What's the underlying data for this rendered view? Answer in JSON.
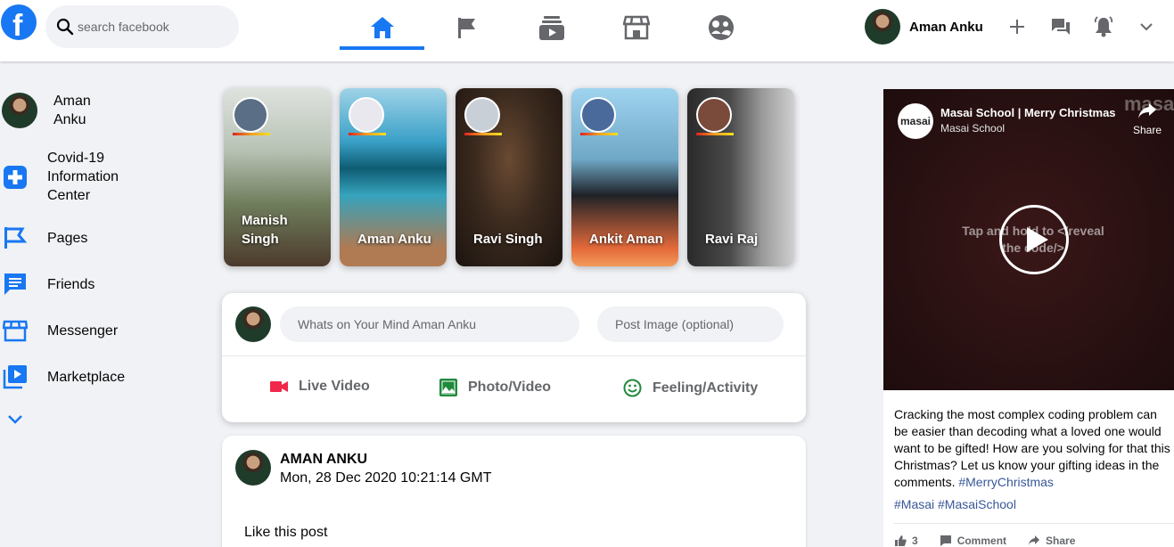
{
  "header": {
    "logo_letter": "f",
    "search_placeholder": "search facebook",
    "user_name": "Aman Anku"
  },
  "nav_icons": [
    "home-icon",
    "flag-icon",
    "watch-icon",
    "marketplace-icon",
    "groups-icon"
  ],
  "sidebar": {
    "user_name": "Aman Anku",
    "items": [
      {
        "label": "Covid-19 Information Center",
        "icon": "plus-box-icon"
      },
      {
        "label": "Pages",
        "icon": "flag-icon"
      },
      {
        "label": "Friends",
        "icon": "message-icon"
      },
      {
        "label": "Messenger",
        "icon": "store-icon"
      },
      {
        "label": "Marketplace",
        "icon": "video-icon"
      }
    ],
    "more_icon": "chevron-down-icon"
  },
  "stories": [
    {
      "name": "Manish Singh"
    },
    {
      "name": "Aman Anku"
    },
    {
      "name": "Ravi Singh"
    },
    {
      "name": "Ankit Aman"
    },
    {
      "name": "Ravi Raj"
    }
  ],
  "composer": {
    "status_placeholder": "Whats on Your Mind Aman Anku",
    "image_placeholder": "Post Image (optional)",
    "actions": [
      "Live Video",
      "Photo/Video",
      "Feeling/Activity"
    ]
  },
  "post": {
    "author": "AMAN ANKU",
    "date": "Mon, 28 Dec 2020 10:21:14 GMT",
    "text": "Like this post"
  },
  "ad": {
    "brand_logo": "masai",
    "video_title": "Masai School | Merry Christmas",
    "channel": "Masai School",
    "share_label": "Share",
    "watermark": "masai",
    "overlay_text": "Tap and hold to </reveal the code/>",
    "body": "Cracking the most complex coding problem can be easier than decoding what a loved one would want to be gifted! How are you solving for that this Christmas? Let us know your gifting ideas in the comments.",
    "hashtag_inline": "#MerryChristmas",
    "hashtags": "#Masai #MasaiSchool",
    "like_count": "3",
    "comment_label": "Comment",
    "share_action": "Share"
  },
  "colors": {
    "brand": "#1877f2",
    "live": "#f02849",
    "photo": "#45bd62",
    "feeling": "#25a244"
  }
}
